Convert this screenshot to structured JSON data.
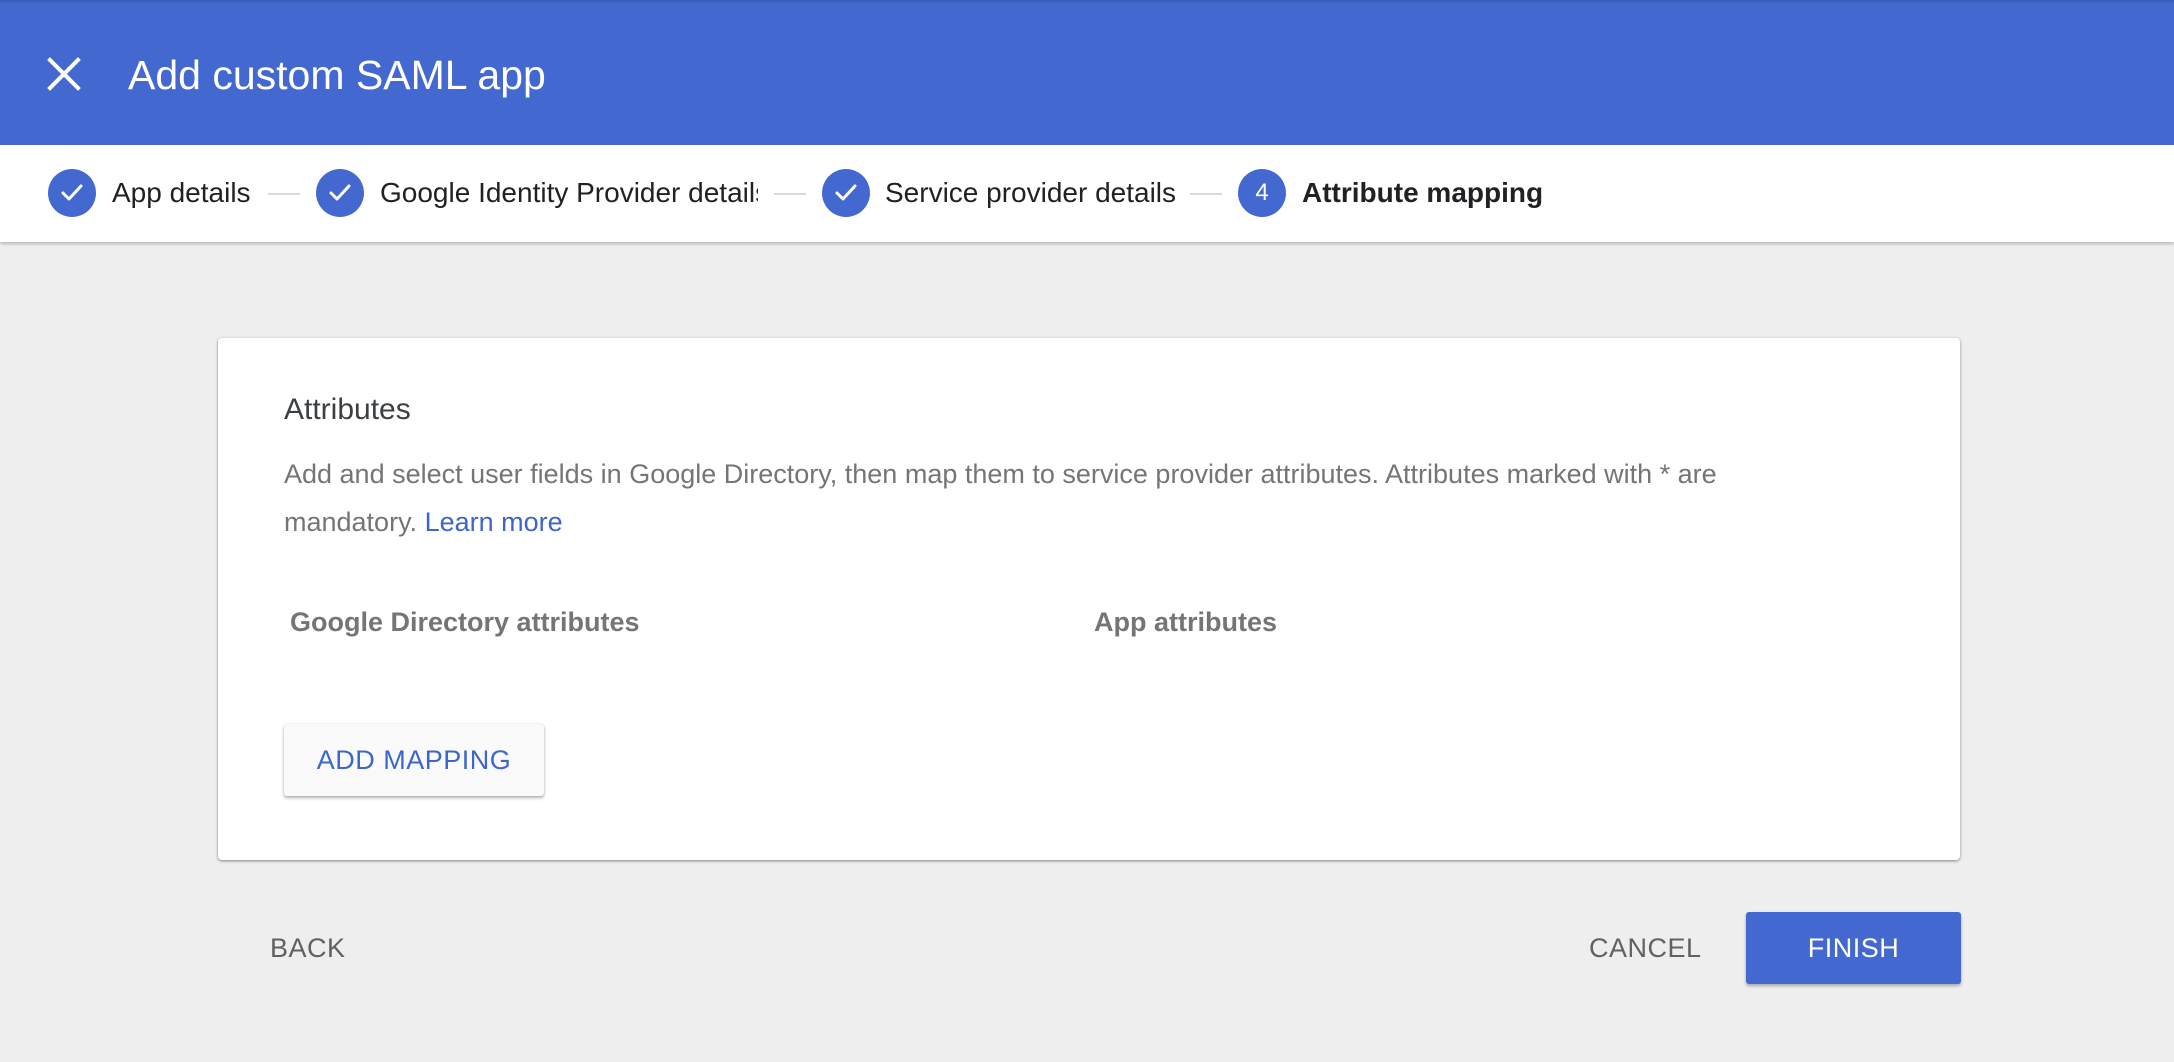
{
  "header": {
    "title": "Add custom SAML app",
    "close_icon": "close-icon"
  },
  "stepper": {
    "steps": [
      {
        "label": "App details",
        "status": "complete",
        "icon": "check-icon"
      },
      {
        "label": "Google Identity Provider details",
        "status": "complete",
        "icon": "check-icon"
      },
      {
        "label": "Service provider details",
        "status": "complete",
        "icon": "check-icon"
      },
      {
        "label": "Attribute mapping",
        "status": "active",
        "number": "4"
      }
    ]
  },
  "card": {
    "title": "Attributes",
    "description": "Add and select user fields in Google Directory, then map them to service provider attributes. Attributes marked with * are mandatory.",
    "learn_more": "Learn more",
    "columns": {
      "google_directory": "Google Directory attributes",
      "app": "App attributes"
    },
    "add_mapping_label": "ADD MAPPING"
  },
  "footer": {
    "back_label": "BACK",
    "cancel_label": "CANCEL",
    "finish_label": "FINISH"
  },
  "colors": {
    "primary": "#4369d0",
    "link": "#3d66cc",
    "background": "#eeeeee"
  }
}
